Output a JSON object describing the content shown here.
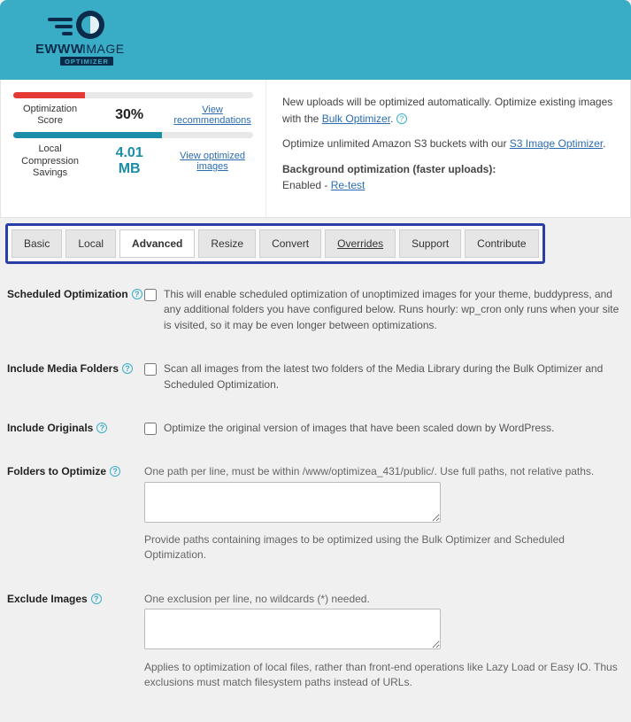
{
  "brand": {
    "name_main": "EWWW",
    "name_light": "IMAGE",
    "subtitle": "OPTIMIZER"
  },
  "dashboard": {
    "score": {
      "label": "Optimization Score",
      "value": "30%",
      "link": "View recommendations",
      "bar_color": "red",
      "bar_pct": 30
    },
    "savings": {
      "label": "Local Compression Savings",
      "value": "4.01 MB",
      "link": "View optimized images",
      "bar_color": "teal",
      "bar_pct": 62
    },
    "info": {
      "auto_upload": "New uploads will be optimized automatically. Optimize existing images with the ",
      "bulk_link": "Bulk Optimizer",
      "s3_line_a": "Optimize unlimited Amazon S3 buckets with our ",
      "s3_link": "S3 Image Optimizer",
      "bg_heading": "Background optimization (faster uploads):",
      "bg_state": "Enabled - ",
      "retest": "Re-test"
    }
  },
  "tabs": {
    "basic": "Basic",
    "local": "Local",
    "advanced": "Advanced",
    "resize": "Resize",
    "convert": "Convert",
    "overrides": "Overrides",
    "support": "Support",
    "contribute": "Contribute",
    "active": "advanced"
  },
  "settings": {
    "scheduled": {
      "label": "Scheduled Optimization",
      "desc": "This will enable scheduled optimization of unoptimized images for your theme, buddypress, and any additional folders you have configured below. Runs hourly: wp_cron only runs when your site is visited, so it may be even longer between optimizations.",
      "checked": false
    },
    "include_media": {
      "label": "Include Media Folders",
      "desc": "Scan all images from the latest two folders of the Media Library during the Bulk Optimizer and Scheduled Optimization.",
      "checked": false
    },
    "include_originals": {
      "label": "Include Originals",
      "desc": "Optimize the original version of images that have been scaled down by WordPress.",
      "checked": false
    },
    "folders": {
      "label": "Folders to Optimize",
      "hint_top": "One path per line, must be within /www/optimizea_431/public/. Use full paths, not relative paths.",
      "value": "",
      "hint_bottom": "Provide paths containing images to be optimized using the Bulk Optimizer and Scheduled Optimization."
    },
    "exclude": {
      "label": "Exclude Images",
      "hint_top": "One exclusion per line, no wildcards (*) needed.",
      "value": "",
      "hint_bottom": "Applies to optimization of local files, rather than front-end operations like Lazy Load or Easy IO. Thus exclusions must match filesystem paths instead of URLs."
    }
  }
}
